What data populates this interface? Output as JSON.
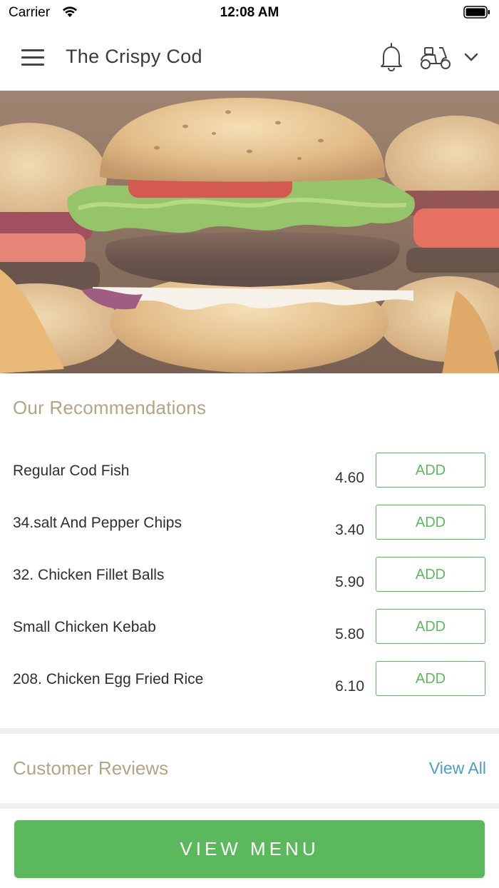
{
  "status_bar": {
    "carrier": "Carrier",
    "time": "12:08 AM"
  },
  "header": {
    "title": "The Crispy Cod",
    "icons": [
      "menu-icon",
      "bell-icon",
      "scooter-icon",
      "chevron-down-icon"
    ]
  },
  "hero": {
    "image": "burger-photo"
  },
  "recommendations": {
    "title": "Our Recommendations",
    "add_label": "ADD",
    "items": [
      {
        "name": "Regular Cod Fish",
        "price": "4.60"
      },
      {
        "name": "34.salt And Pepper Chips",
        "price": "3.40"
      },
      {
        "name": "32. Chicken Fillet Balls",
        "price": "5.90"
      },
      {
        "name": "Small Chicken Kebab",
        "price": "5.80"
      },
      {
        "name": "208. Chicken Egg Fried Rice",
        "price": "6.10"
      }
    ]
  },
  "reviews": {
    "title": "Customer Reviews",
    "view_all": "View All"
  },
  "footer": {
    "view_menu": "VIEW MENU"
  },
  "colors": {
    "accent_green": "#5cb85c",
    "section_title": "#b3a484",
    "link_blue": "#4a9fc4"
  }
}
